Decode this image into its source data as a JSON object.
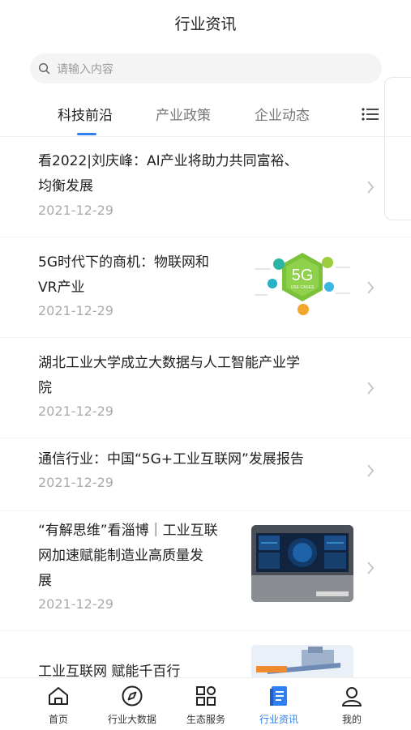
{
  "header": {
    "title": "行业资讯"
  },
  "search": {
    "placeholder": "请输入内容"
  },
  "tabs": [
    {
      "label": "科技前沿",
      "active": true
    },
    {
      "label": "产业政策",
      "active": false
    },
    {
      "label": "企业动态",
      "active": false
    }
  ],
  "articles": [
    {
      "title_lines": [
        "看2022|刘庆峰：AI产业将助力共同富裕、",
        "均衡发展"
      ],
      "date": "2021-12-29"
    },
    {
      "title_lines": [
        "5G时代下的商机：物联网和",
        "VR产业"
      ],
      "date": "2021-12-29",
      "thumb_text": "5G",
      "thumb_sub": "USE CASES"
    },
    {
      "title_lines": [
        "湖北工业大学成立大数据与人工智能产业学",
        "院"
      ],
      "date": "2021-12-29"
    },
    {
      "title_lines": [
        "通信行业：中国“5G+工业互联网”发展报告"
      ],
      "date": "2021-12-29"
    },
    {
      "title_lines": [
        "“有解思维”看淄博｜工业互联",
        "网加速赋能制造业高质量发",
        "展"
      ],
      "date": "2021-12-29"
    },
    {
      "title_lines": [
        "工业互联网 赋能千百行"
      ]
    }
  ],
  "bottom_nav": [
    {
      "label": "首页",
      "icon": "home-icon",
      "active": false
    },
    {
      "label": "行业大数据",
      "icon": "compass-icon",
      "active": false
    },
    {
      "label": "生态服务",
      "icon": "grid-icon",
      "active": false
    },
    {
      "label": "行业资讯",
      "icon": "news-icon",
      "active": true
    },
    {
      "label": "我的",
      "icon": "user-icon",
      "active": false
    }
  ],
  "colors": {
    "accent": "#2f7ff2",
    "text": "#1f1f1f",
    "muted": "#aaaaaa"
  }
}
